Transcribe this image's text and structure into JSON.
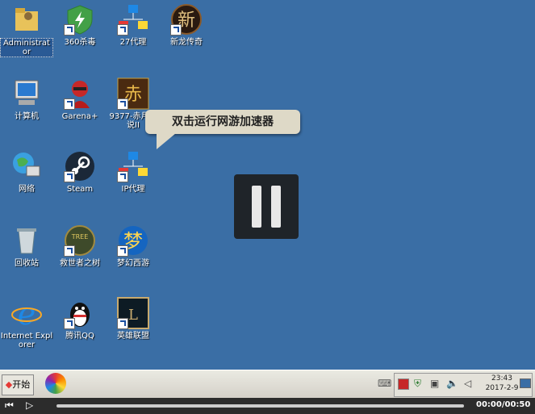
{
  "desktop": {
    "icons": [
      {
        "label": "Administrator"
      },
      {
        "label": "360杀毒"
      },
      {
        "label": "27代理"
      },
      {
        "label": "新龙传奇"
      },
      {
        "label": "计算机"
      },
      {
        "label": "Garena+"
      },
      {
        "label": "9377-赤月传说II"
      },
      {
        "label": "网络"
      },
      {
        "label": "Steam"
      },
      {
        "label": "IP代理"
      },
      {
        "label": "回收站"
      },
      {
        "label": "救世者之树"
      },
      {
        "label": "梦幻西游"
      },
      {
        "label": "Internet Explorer"
      },
      {
        "label": "腾讯QQ"
      },
      {
        "label": "英雄联盟"
      }
    ],
    "tooltip": "双击运行网游加速器"
  },
  "taskbar": {
    "start_label": "开始",
    "clock_time": "23:43",
    "clock_date": "2017-2-9"
  },
  "player": {
    "time": "00:00/00:50",
    "progress": 0
  },
  "colors": {
    "desktop": "#3a6ea5",
    "taskbar": "#d4d0c8"
  }
}
